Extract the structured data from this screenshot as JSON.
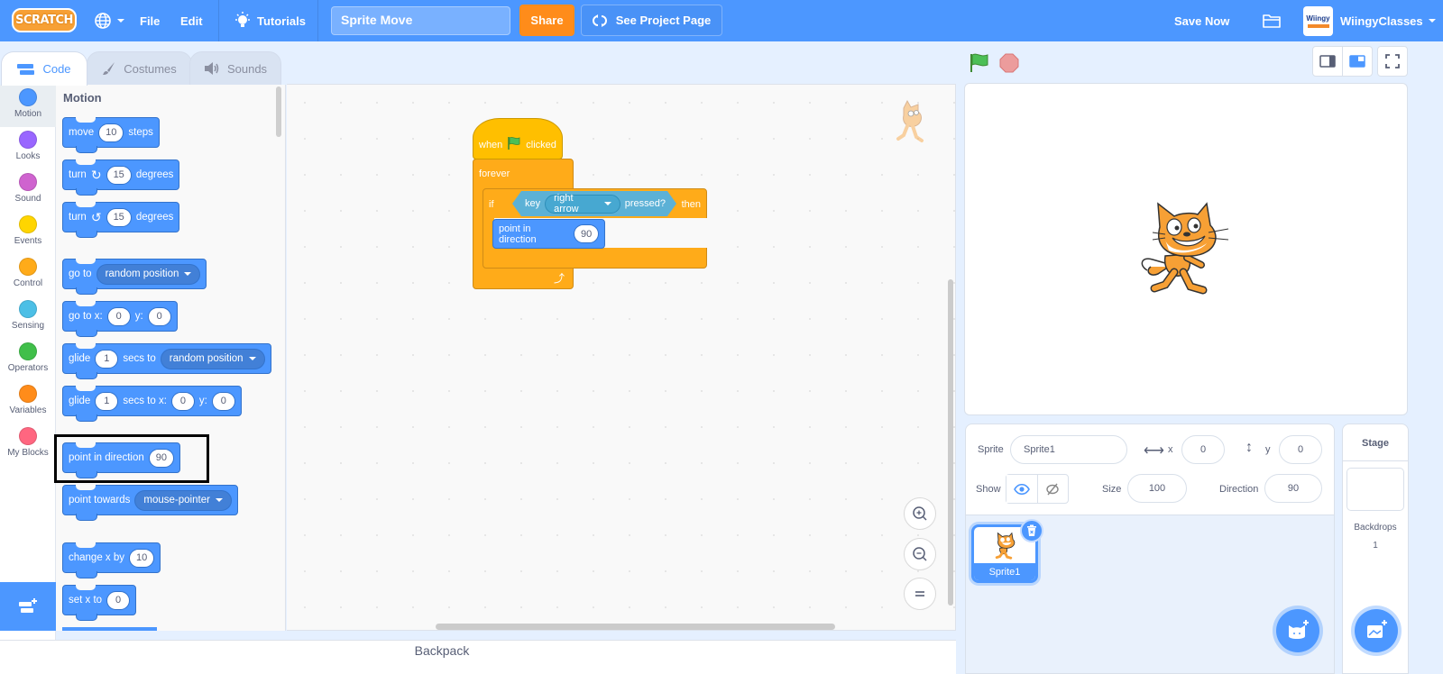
{
  "menubar": {
    "logo": "SCRATCH",
    "language_icon": "globe-icon",
    "file": "File",
    "edit": "Edit",
    "tutorials": "Tutorials",
    "project_title": "Sprite Move",
    "share": "Share",
    "see_project_page": "See Project Page",
    "save_now": "Save Now",
    "username": "WiingyClasses",
    "avatar_text": "Wiingy"
  },
  "tabs": [
    {
      "label": "Code",
      "icon": "code-icon",
      "active": true
    },
    {
      "label": "Costumes",
      "icon": "brush-icon",
      "active": false
    },
    {
      "label": "Sounds",
      "icon": "speaker-icon",
      "active": false
    }
  ],
  "categories": [
    {
      "label": "Motion",
      "color": "#4c97ff",
      "active": true
    },
    {
      "label": "Looks",
      "color": "#9966ff"
    },
    {
      "label": "Sound",
      "color": "#cf63cf"
    },
    {
      "label": "Events",
      "color": "#ffd500"
    },
    {
      "label": "Control",
      "color": "#ffab19"
    },
    {
      "label": "Sensing",
      "color": "#4cbfe6"
    },
    {
      "label": "Operators",
      "color": "#40bf4a"
    },
    {
      "label": "Variables",
      "color": "#ff8c1a"
    },
    {
      "label": "My Blocks",
      "color": "#ff6680"
    }
  ],
  "palette": {
    "section": "Motion",
    "blocks": {
      "move": {
        "t1": "move",
        "v1": "10",
        "t2": "steps"
      },
      "turn_right": {
        "t1": "turn",
        "v1": "15",
        "t2": "degrees"
      },
      "turn_left": {
        "t1": "turn",
        "v1": "15",
        "t2": "degrees"
      },
      "goto": {
        "t1": "go to",
        "d1": "random position"
      },
      "gotoxy": {
        "t1": "go to x:",
        "v1": "0",
        "t2": "y:",
        "v2": "0"
      },
      "glide_to": {
        "t1": "glide",
        "v1": "1",
        "t2": "secs to",
        "d1": "random position"
      },
      "glide_xy": {
        "t1": "glide",
        "v1": "1",
        "t2": "secs to x:",
        "v2": "0",
        "t3": "y:",
        "v3": "0"
      },
      "point_dir": {
        "t1": "point in direction",
        "v1": "90"
      },
      "point_towards": {
        "t1": "point towards",
        "d1": "mouse-pointer"
      },
      "change_x": {
        "t1": "change x by",
        "v1": "10"
      },
      "set_x": {
        "t1": "set x to",
        "v1": "0"
      }
    }
  },
  "script": {
    "hat_when": "when",
    "hat_clicked": "clicked",
    "forever": "forever",
    "if": "if",
    "then": "then",
    "key": "key",
    "key_value": "right arrow",
    "pressed": "pressed?",
    "point_label": "point in direction",
    "point_value": "90"
  },
  "backpack": "Backpack",
  "sprite_info": {
    "sprite_label": "Sprite",
    "sprite_name": "Sprite1",
    "x_label": "x",
    "x_value": "0",
    "y_label": "y",
    "y_value": "0",
    "show_label": "Show",
    "size_label": "Size",
    "size_value": "100",
    "direction_label": "Direction",
    "direction_value": "90"
  },
  "sprites": [
    {
      "name": "Sprite1",
      "selected": true
    }
  ],
  "stage_pane": {
    "title": "Stage",
    "backdrops_label": "Backdrops",
    "backdrops_count": "1"
  }
}
